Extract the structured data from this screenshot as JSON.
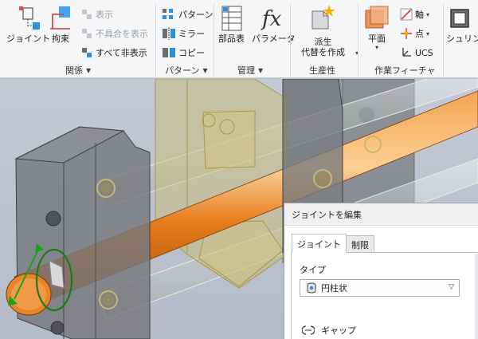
{
  "ribbon": {
    "relations": {
      "joint_label": "ジョイント",
      "constrain_label": "拘束",
      "show_label": "表示",
      "show_sick_label": "不具合を表示",
      "hide_all_label": "すべて非表示",
      "group_title": "関係"
    },
    "pattern": {
      "pattern_label": "パターン",
      "mirror_label": "ミラー",
      "copy_label": "コピー",
      "group_title": "パターン"
    },
    "manage": {
      "bom_label": "部品表",
      "params_label": "パラメータ",
      "group_title": "管理"
    },
    "productivity": {
      "substitute_label_1": "派生",
      "substitute_label_2": "代替を作成",
      "group_title": "生産性"
    },
    "work_features": {
      "plane_label": "平面",
      "axis_label": "軸",
      "point_label": "点",
      "ucs_label": "UCS",
      "group_title": "作業フィーチャ"
    },
    "simplify": {
      "shrinkwrap_label": "シュリンク"
    }
  },
  "dialog": {
    "title": "ジョイントを編集",
    "tabs": [
      {
        "label": "ジョイント",
        "active": true
      },
      {
        "label": "制限",
        "active": false
      }
    ],
    "type_label": "タイプ",
    "type_value": "円柱状",
    "gap_label": "ギャップ"
  },
  "colors": {
    "shaft": "#e8852a",
    "housing": "#7e8084",
    "translucent_block": "#cdbb6a",
    "gizmo": "#1aa31a",
    "ribbon_bg": "#f5f6f7"
  }
}
